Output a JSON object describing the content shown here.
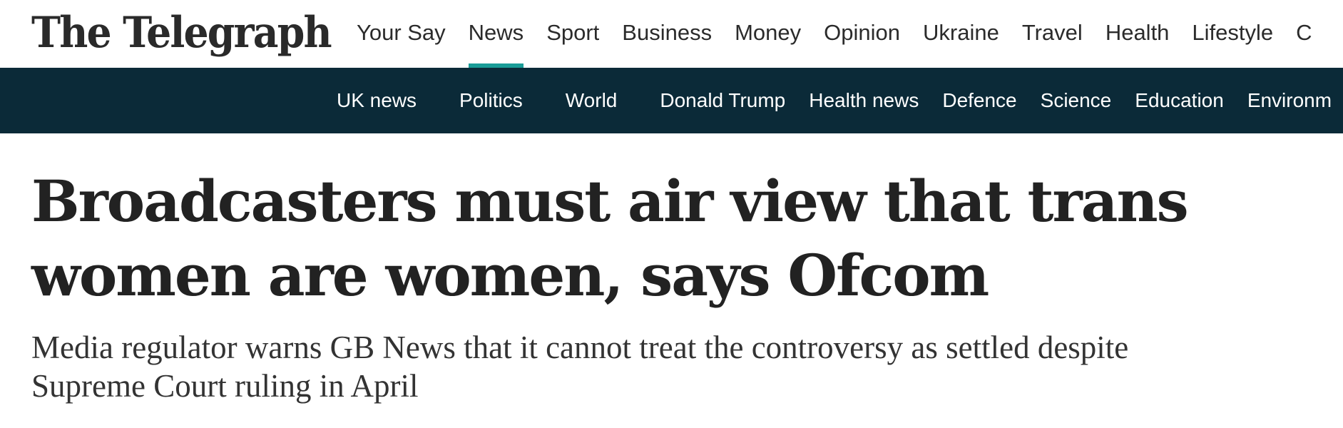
{
  "masthead": {
    "logo_text": "The Telegraph"
  },
  "primary_nav": {
    "items": [
      {
        "label": "Your Say"
      },
      {
        "label": "News",
        "active": true
      },
      {
        "label": "Sport"
      },
      {
        "label": "Business"
      },
      {
        "label": "Money"
      },
      {
        "label": "Opinion"
      },
      {
        "label": "Ukraine"
      },
      {
        "label": "Travel"
      },
      {
        "label": "Health"
      },
      {
        "label": "Lifestyle"
      },
      {
        "label": "C"
      }
    ],
    "active_color": "#1a9c97"
  },
  "secondary_nav": {
    "background": "#0b2a38",
    "items": [
      {
        "label": "UK news"
      },
      {
        "label": "Politics"
      },
      {
        "label": "World"
      },
      {
        "label": "Donald Trump"
      },
      {
        "label": "Health news"
      },
      {
        "label": "Defence"
      },
      {
        "label": "Science"
      },
      {
        "label": "Education"
      },
      {
        "label": "Environm"
      }
    ]
  },
  "article": {
    "headline_line1": "Broadcasters must air view that trans",
    "headline_line2": "women are women, says Ofcom",
    "standfirst_line1": "Media regulator warns GB News that it cannot treat the controversy as settled despite",
    "standfirst_line2": "Supreme Court ruling in April"
  }
}
